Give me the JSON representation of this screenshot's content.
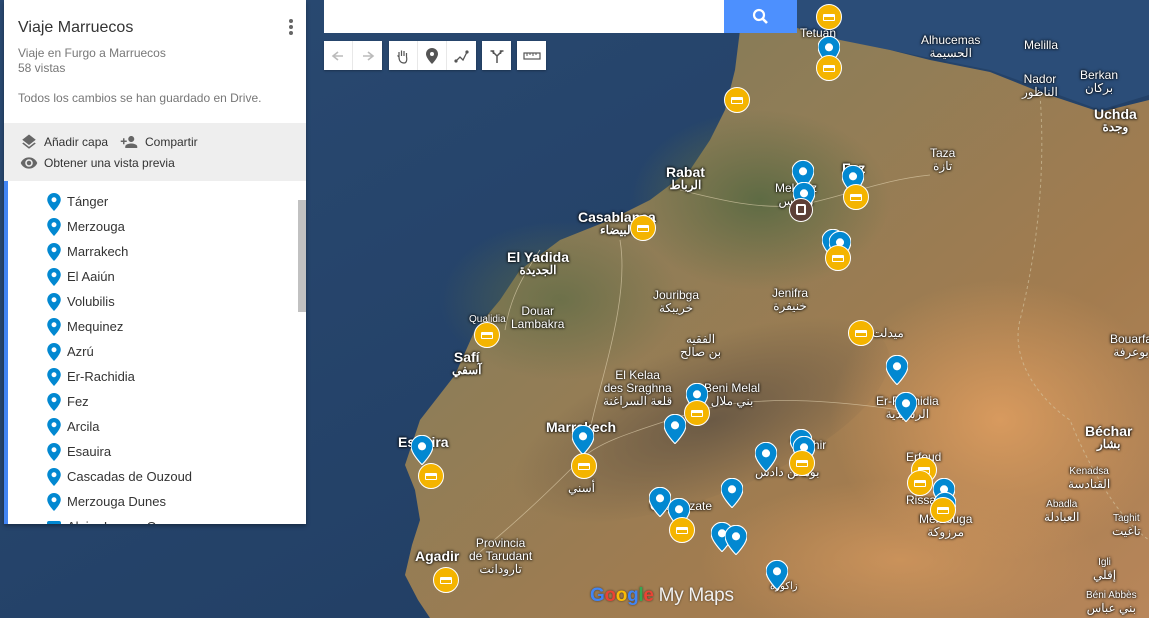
{
  "map": {
    "title": "Viaje Marruecos",
    "subtitle": "Viaje en Furgo a Marruecos",
    "views": "58 vistas",
    "saved_status": "Todos los cambios se han guardado en Drive.",
    "actions": {
      "add_layer": "Añadir capa",
      "share": "Compartir",
      "preview": "Obtener una vista previa"
    },
    "places": [
      "Tánger",
      "Merzouga",
      "Marrakech",
      "El Aaiún",
      "Volubilis",
      "Mequinez",
      "Azrú",
      "Er-Rachidia",
      "Fez",
      "Arcila",
      "Esauira",
      "Cascadas de Ouzoud",
      "Merzouga Dunes",
      "Alojar Luxury Camp"
    ],
    "accent_color": "#4285f4",
    "pin_color": "#0288d1",
    "hotel_color": "#f4b400"
  },
  "search": {
    "placeholder": ""
  },
  "toolbar": {
    "icons": [
      "undo-icon",
      "redo-icon",
      "hand-icon",
      "marker-icon",
      "draw-line-icon",
      "directions-icon",
      "ruler-icon"
    ]
  },
  "labels": {
    "tetuan": "Tetuan",
    "alhucemas": "Alhucemas",
    "alhucemas_ar": "الحسيمة",
    "melilla": "Melilla",
    "nador": "Nador",
    "nador_ar": "الناظور",
    "berkan": "Berkan",
    "berkan_ar": "بركان",
    "uchda": "Uchda",
    "uchda_ar": "وجدة",
    "taza": "Taza",
    "taza_ar": "تازة",
    "rabat": "Rabat",
    "rabat_ar": "الرباط",
    "meknez": "Meknez",
    "meknez_ar": "مكناس",
    "fez": "Fez",
    "casablanca": "Casablanca",
    "casablanca_ar": "البيضاء",
    "elyadida": "El Yadida",
    "elyadida_ar": "الجديدة",
    "douar": "Douar",
    "lambakra": "Lambakra",
    "jouribga": "Jouribga",
    "jouribga_ar": "خريبكة",
    "jenifra": "Jenifra",
    "jenifra_ar": "خنيفرة",
    "alfaqih": "الفقيه",
    "bensalah": "بن صالح",
    "qualidia": "Qualidia",
    "safi": "Safí",
    "safi_ar": "آسفي",
    "kelaa": "El Kelaa",
    "kelaa2": "des Sraghna",
    "kelaa_ar": "قلعة السراغنة",
    "benimelal": "Beni Melal",
    "benimelal_ar": "بني ملال",
    "marrakech": "Marrakech",
    "midelt": "ميدلت",
    "bouarfa": "Bouarfa",
    "bouarfa_ar": "بوعرفة",
    "errachidia": "Er-Rachidia",
    "errachidia_ar": "الرشيدية",
    "tinghir": "Tinghir",
    "dades": "بومالن دادس",
    "erfoud": "Erfoud",
    "rissani": "Rissani",
    "merzouga": "Merzouga",
    "merzouga_ar": "مرزوكة",
    "bechar": "Béchar",
    "bechar_ar": "بشار",
    "kenadsa": "Kenadsa",
    "kenadsa_ar": "القنادسة",
    "abadla": "Abadla",
    "abadla_ar": "العبادلة",
    "taghit": "Taghit",
    "taghit_ar": "تاغيت",
    "esauira": "Esauira",
    "ouarzazate": "Ouarzazate",
    "asni": "أسني",
    "tarudant1": "Provincia",
    "tarudant2": "de Tarudant",
    "tarudant_ar": "تارودانت",
    "agadir": "Agadir",
    "igli": "Igli",
    "igli_ar": "إقلي",
    "beniabbes": "Béni Abbès",
    "beniabbes_ar": "بني عباس",
    "zagora": "زاكورة"
  },
  "branding": {
    "google": "Google",
    "mymaps": "My Maps"
  }
}
